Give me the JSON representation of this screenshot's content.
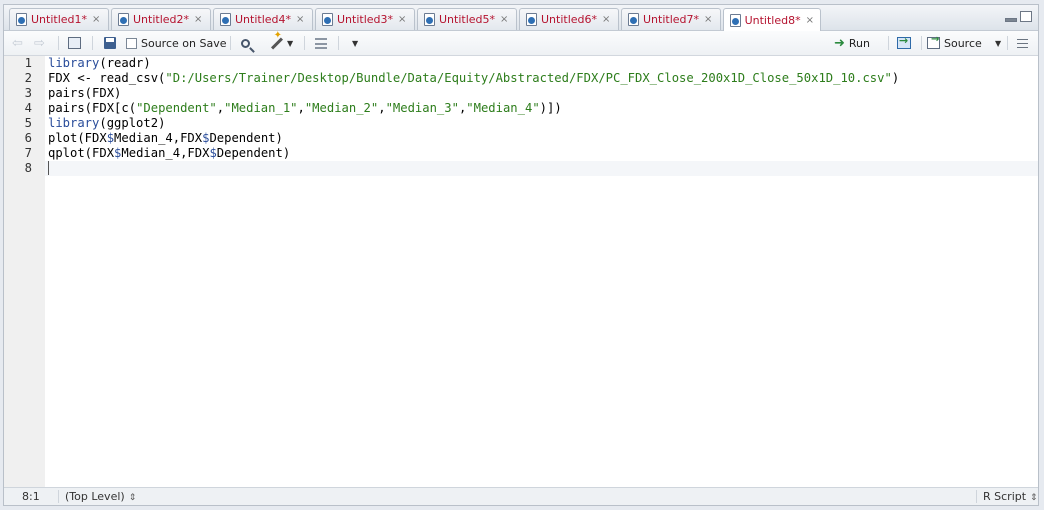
{
  "tabs": [
    {
      "label": "Untitled1*"
    },
    {
      "label": "Untitled2*"
    },
    {
      "label": "Untitled4*"
    },
    {
      "label": "Untitled3*"
    },
    {
      "label": "Untitled5*"
    },
    {
      "label": "Untitled6*"
    },
    {
      "label": "Untitled7*"
    },
    {
      "label": "Untitled8*",
      "active": true
    }
  ],
  "tab_close_glyph": "×",
  "toolbar": {
    "source_on_save_label": "Source on Save",
    "source_on_save_checked": false,
    "run_label": "Run",
    "source_label": "Source"
  },
  "editor": {
    "lines": [
      {
        "num": "1",
        "parts": [
          {
            "t": "library",
            "c": "kw"
          },
          {
            "t": "(readr)",
            "c": ""
          }
        ]
      },
      {
        "num": "2",
        "parts": [
          {
            "t": "FDX <- read_csv(",
            "c": ""
          },
          {
            "t": "\"D:/Users/Trainer/Desktop/Bundle/Data/Equity/Abstracted/FDX/PC_FDX_Close_200x1D_Close_50x1D_10.csv\"",
            "c": "str"
          },
          {
            "t": ")",
            "c": ""
          }
        ]
      },
      {
        "num": "3",
        "parts": [
          {
            "t": "pairs(FDX)",
            "c": ""
          }
        ]
      },
      {
        "num": "4",
        "parts": [
          {
            "t": "pairs(FDX[c(",
            "c": ""
          },
          {
            "t": "\"Dependent\"",
            "c": "str"
          },
          {
            "t": ",",
            "c": ""
          },
          {
            "t": "\"Median_1\"",
            "c": "str"
          },
          {
            "t": ",",
            "c": ""
          },
          {
            "t": "\"Median_2\"",
            "c": "str"
          },
          {
            "t": ",",
            "c": ""
          },
          {
            "t": "\"Median_3\"",
            "c": "str"
          },
          {
            "t": ",",
            "c": ""
          },
          {
            "t": "\"Median_4\"",
            "c": "str"
          },
          {
            "t": ")])",
            "c": ""
          }
        ]
      },
      {
        "num": "5",
        "parts": [
          {
            "t": "library",
            "c": "kw"
          },
          {
            "t": "(ggplot2)",
            "c": ""
          }
        ]
      },
      {
        "num": "6",
        "parts": [
          {
            "t": "plot(FDX",
            "c": ""
          },
          {
            "t": "$",
            "c": "kw"
          },
          {
            "t": "Median_4,FDX",
            "c": ""
          },
          {
            "t": "$",
            "c": "kw"
          },
          {
            "t": "Dependent)",
            "c": ""
          }
        ]
      },
      {
        "num": "7",
        "parts": [
          {
            "t": "qplot(FDX",
            "c": ""
          },
          {
            "t": "$",
            "c": "kw"
          },
          {
            "t": "Median_4,FDX",
            "c": ""
          },
          {
            "t": "$",
            "c": "kw"
          },
          {
            "t": "Dependent)",
            "c": ""
          }
        ]
      },
      {
        "num": "8",
        "parts": []
      }
    ]
  },
  "status": {
    "position": "8:1",
    "scope": "(Top Level)",
    "file_type": "R Script"
  },
  "colors": {
    "tab_text": "#b5132f",
    "keyword": "#2a4d9b",
    "string": "#2d7d1b"
  }
}
